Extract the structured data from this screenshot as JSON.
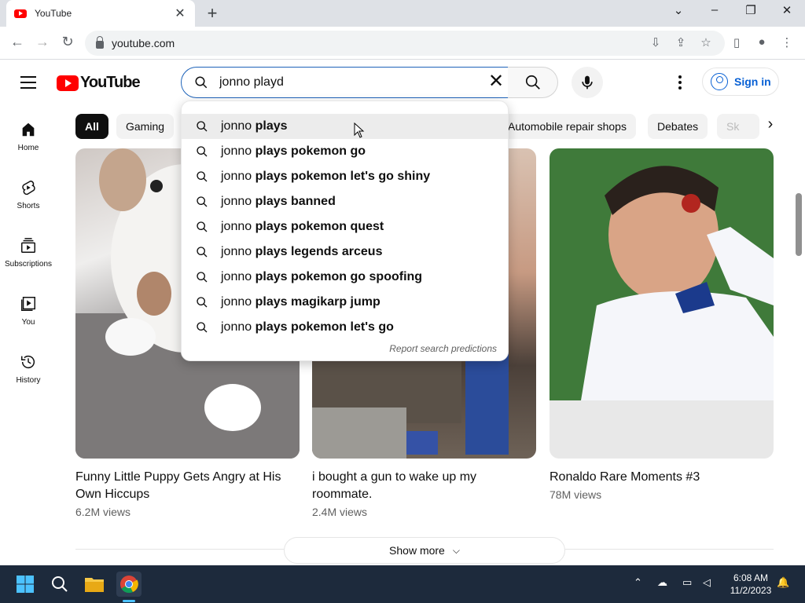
{
  "browser": {
    "tab_title": "YouTube",
    "url": "youtube.com"
  },
  "youtube": {
    "logo_text": "YouTube",
    "search_query": "jonno playd",
    "signin_label": "Sign in",
    "guide": [
      {
        "label": "Home",
        "icon": "home-icon"
      },
      {
        "label": "Shorts",
        "icon": "shorts-icon"
      },
      {
        "label": "Subscriptions",
        "icon": "subscriptions-icon"
      },
      {
        "label": "You",
        "icon": "library-icon"
      },
      {
        "label": "History",
        "icon": "history-icon"
      }
    ],
    "chips": [
      "All",
      "Gaming",
      "Automobile repair shops",
      "Debates",
      "Sk"
    ],
    "suggestions": [
      {
        "typed": "jonno",
        "rest": " plays"
      },
      {
        "typed": "jonno",
        "rest": " plays pokemon go"
      },
      {
        "typed": "jonno",
        "rest": " plays pokemon let's go shiny"
      },
      {
        "typed": "jonno",
        "rest": " plays banned"
      },
      {
        "typed": "jonno",
        "rest": " plays pokemon quest"
      },
      {
        "typed": "jonno",
        "rest": " plays legends arceus"
      },
      {
        "typed": "jonno",
        "rest": " plays pokemon go spoofing"
      },
      {
        "typed": "jonno",
        "rest": " plays magikarp jump"
      },
      {
        "typed": "jonno",
        "rest": " plays pokemon let's go"
      }
    ],
    "report_predictions": "Report search predictions",
    "videos": [
      {
        "title": "Funny Little Puppy Gets Angry at His Own Hiccups",
        "views": "6.2M views"
      },
      {
        "title": "i bought a gun to wake up my roommate.",
        "views": "2.4M views"
      },
      {
        "title": "Ronaldo Rare Moments #3",
        "views": "78M views"
      }
    ],
    "show_more": "Show more"
  },
  "taskbar": {
    "time": "6:08 AM",
    "date": "11/2/2023"
  },
  "colors": {
    "youtube_red": "#ff0000",
    "link_blue": "#065fd4",
    "taskbar": "#1d2a3c"
  }
}
